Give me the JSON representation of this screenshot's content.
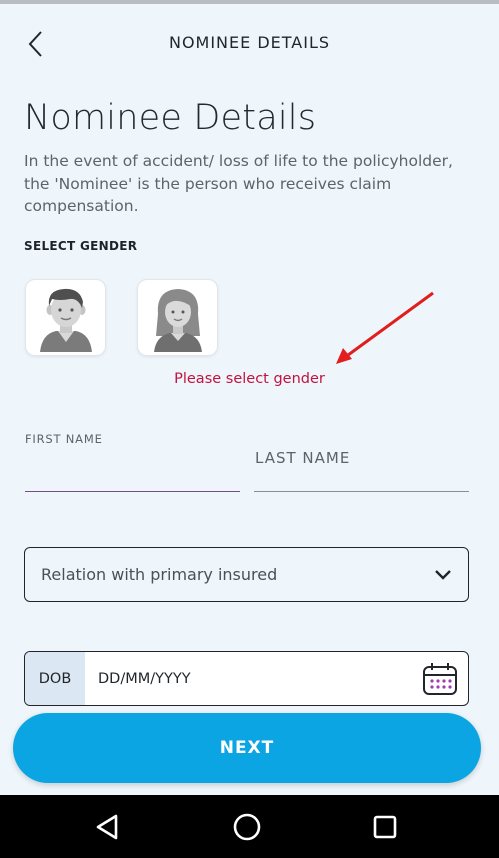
{
  "header": {
    "title": "NOMINEE DETAILS",
    "back_icon": "chevron-left-icon"
  },
  "main": {
    "title": "Nominee Details",
    "description": "In the event of accident/ loss of life to the policyholder, the 'Nominee' is the person who receives claim compensation.",
    "gender_label": "SELECT GENDER",
    "gender_options": [
      "male-avatar-icon",
      "female-avatar-icon"
    ],
    "gender_error": "Please select gender",
    "error_color": "#c2123e",
    "first_name": {
      "label": "FIRST NAME",
      "value": ""
    },
    "last_name": {
      "placeholder": "LAST NAME",
      "value": ""
    },
    "relation": {
      "placeholder": "Relation with primary insured"
    },
    "dob": {
      "tag": "DOB",
      "placeholder": "DD/MM/YYYY"
    },
    "next_label": "NEXT",
    "accent_color": "#0aa5e2"
  },
  "nav_bar": {
    "icons": [
      "back-triangle-icon",
      "home-circle-icon",
      "recents-square-icon"
    ]
  }
}
